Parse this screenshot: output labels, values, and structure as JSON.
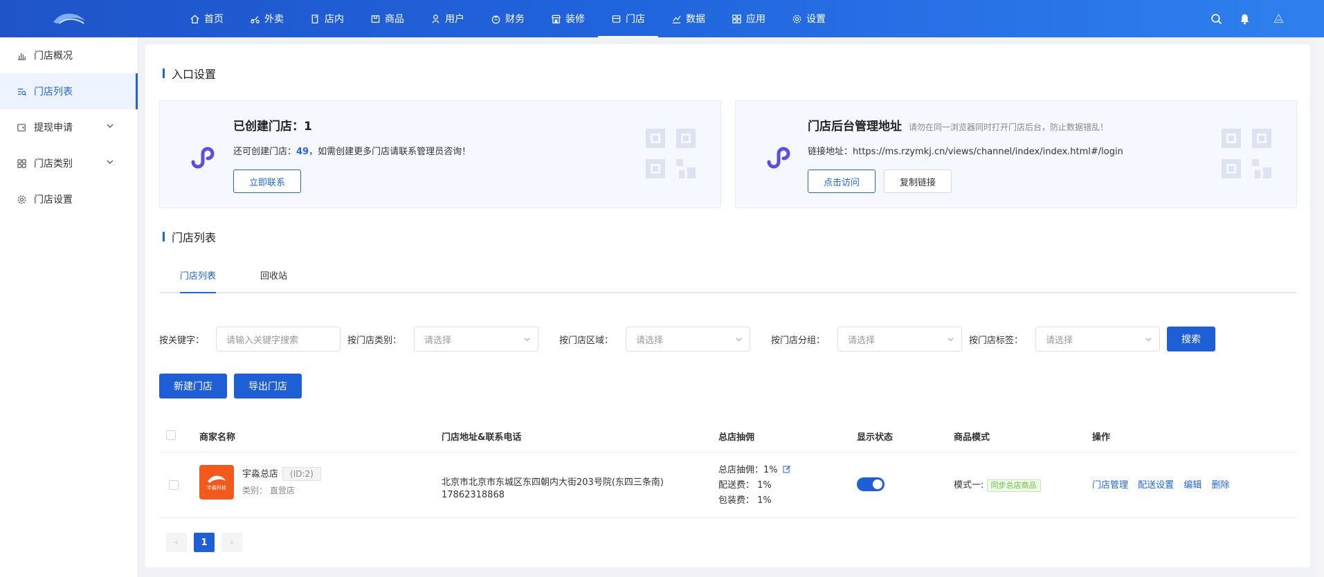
{
  "header": {
    "nav": [
      {
        "label": "首页",
        "icon": "home-icon"
      },
      {
        "label": "外卖",
        "icon": "delivery-icon"
      },
      {
        "label": "店内",
        "icon": "door-icon"
      },
      {
        "label": "商品",
        "icon": "box-icon"
      },
      {
        "label": "用户",
        "icon": "user-icon"
      },
      {
        "label": "财务",
        "icon": "wallet-icon"
      },
      {
        "label": "装修",
        "icon": "shop-decor-icon"
      },
      {
        "label": "门店",
        "icon": "store-icon",
        "active": true
      },
      {
        "label": "数据",
        "icon": "chart-icon"
      },
      {
        "label": "应用",
        "icon": "apps-icon"
      },
      {
        "label": "设置",
        "icon": "gear-icon"
      }
    ]
  },
  "sidebar": {
    "items": [
      {
        "label": "门店概况",
        "icon": "bar-chart-icon"
      },
      {
        "label": "门店列表",
        "icon": "list-search-icon",
        "active": true
      },
      {
        "label": "提现申请",
        "icon": "withdraw-icon",
        "expandable": true
      },
      {
        "label": "门店类别",
        "icon": "grid-icon",
        "expandable": true
      },
      {
        "label": "门店设置",
        "icon": "gear-icon"
      }
    ]
  },
  "entry": {
    "section_title": "入口设置",
    "card1": {
      "title": "已创建门店：1",
      "line_prefix": "还可创建门店：",
      "line_count": "49",
      "line_suffix": "，如需创建更多门店请联系管理员咨询！",
      "button": "立即联系"
    },
    "card2": {
      "title": "门店后台管理地址",
      "hint": "请勿在同一浏览器同时打开门店后台，防止数据错乱！",
      "link_line": "链接地址：https://ms.rzymkj.cn/views/channel/index/index.html#/login",
      "visit_button": "点击访问",
      "copy_button": "复制链接"
    }
  },
  "store_list": {
    "section_title": "门店列表",
    "tabs": [
      "门店列表",
      "回收站"
    ],
    "filters": {
      "keyword_label": "按关键字：",
      "keyword_placeholder": "请输入关键字搜索",
      "category_label": "按门店类别：",
      "region_label": "按门店区域：",
      "group_label": "按门店分组：",
      "tag_label": "按门店标签：",
      "select_placeholder": "请选择",
      "search_button": "搜索"
    },
    "actions": {
      "new": "新建门店",
      "export": "导出门店"
    },
    "columns": [
      "商家名称",
      "门店地址&联系电话",
      "总店抽佣",
      "显示状态",
      "商品模式",
      "操作"
    ],
    "rows": [
      {
        "logo_text": "宇淼科技",
        "name": "宇淼总店",
        "id": "(ID:2)",
        "category": "类别：  直营店",
        "address": "北京市北京市东城区东四朝内大街203号院(东四三条南)",
        "phone": "17862318868",
        "commission": "总店抽佣：1%",
        "delivery_fee": "配送费：  1%",
        "package_fee": "包装费：  1%",
        "mode_label": "模式一:",
        "mode_tag": "同步总店商品",
        "ops": [
          "门店管理",
          "配送设置",
          "编辑",
          "删除"
        ]
      }
    ],
    "pagination": {
      "current": "1",
      "prev": "‹",
      "next": "›"
    }
  }
}
